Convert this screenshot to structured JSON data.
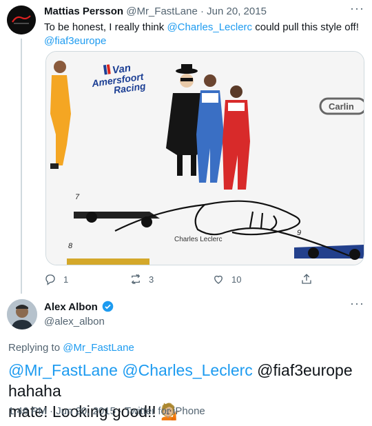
{
  "tweet1": {
    "display_name": "Mattias Persson",
    "handle": "@Mr_FastLane",
    "separator": "·",
    "date": "Jun 20, 2015",
    "text_part1": "To be honest, I really think ",
    "mention": "@Charles_Leclerc",
    "text_part2": " could pull this style off!",
    "text_line2": "@fiaf3europe",
    "media": {
      "logo_line1": "Van",
      "logo_line2": "Amersfoort",
      "logo_line3": "Racing",
      "car_number_7": "7",
      "car_number_8": "8",
      "car_number_9": "9",
      "signature_caption": "Charles Leclerc",
      "sponsor_text": "Carlin"
    },
    "actions": {
      "reply_count": "1",
      "retweet_count": "3",
      "like_count": "10"
    }
  },
  "tweet2": {
    "display_name": "Alex Albon",
    "handle": "@alex_albon",
    "replying_label": "Replying to ",
    "replying_to": "@Mr_FastLane",
    "mention1": "@Mr_FastLane",
    "mention2": "@Charles_Leclerc",
    "text_part": " @fiaf3europe hahaha",
    "text_line2": "mate! Looking good!! ",
    "emoji": "💁🏼",
    "time": "1:46 PM",
    "date": "Jun 20, 2015",
    "source": "Twitter for iPhone",
    "separator": "·"
  },
  "colors": {
    "link": "#1d9bf0",
    "muted": "#536471",
    "verified": "#1d9bf0"
  }
}
